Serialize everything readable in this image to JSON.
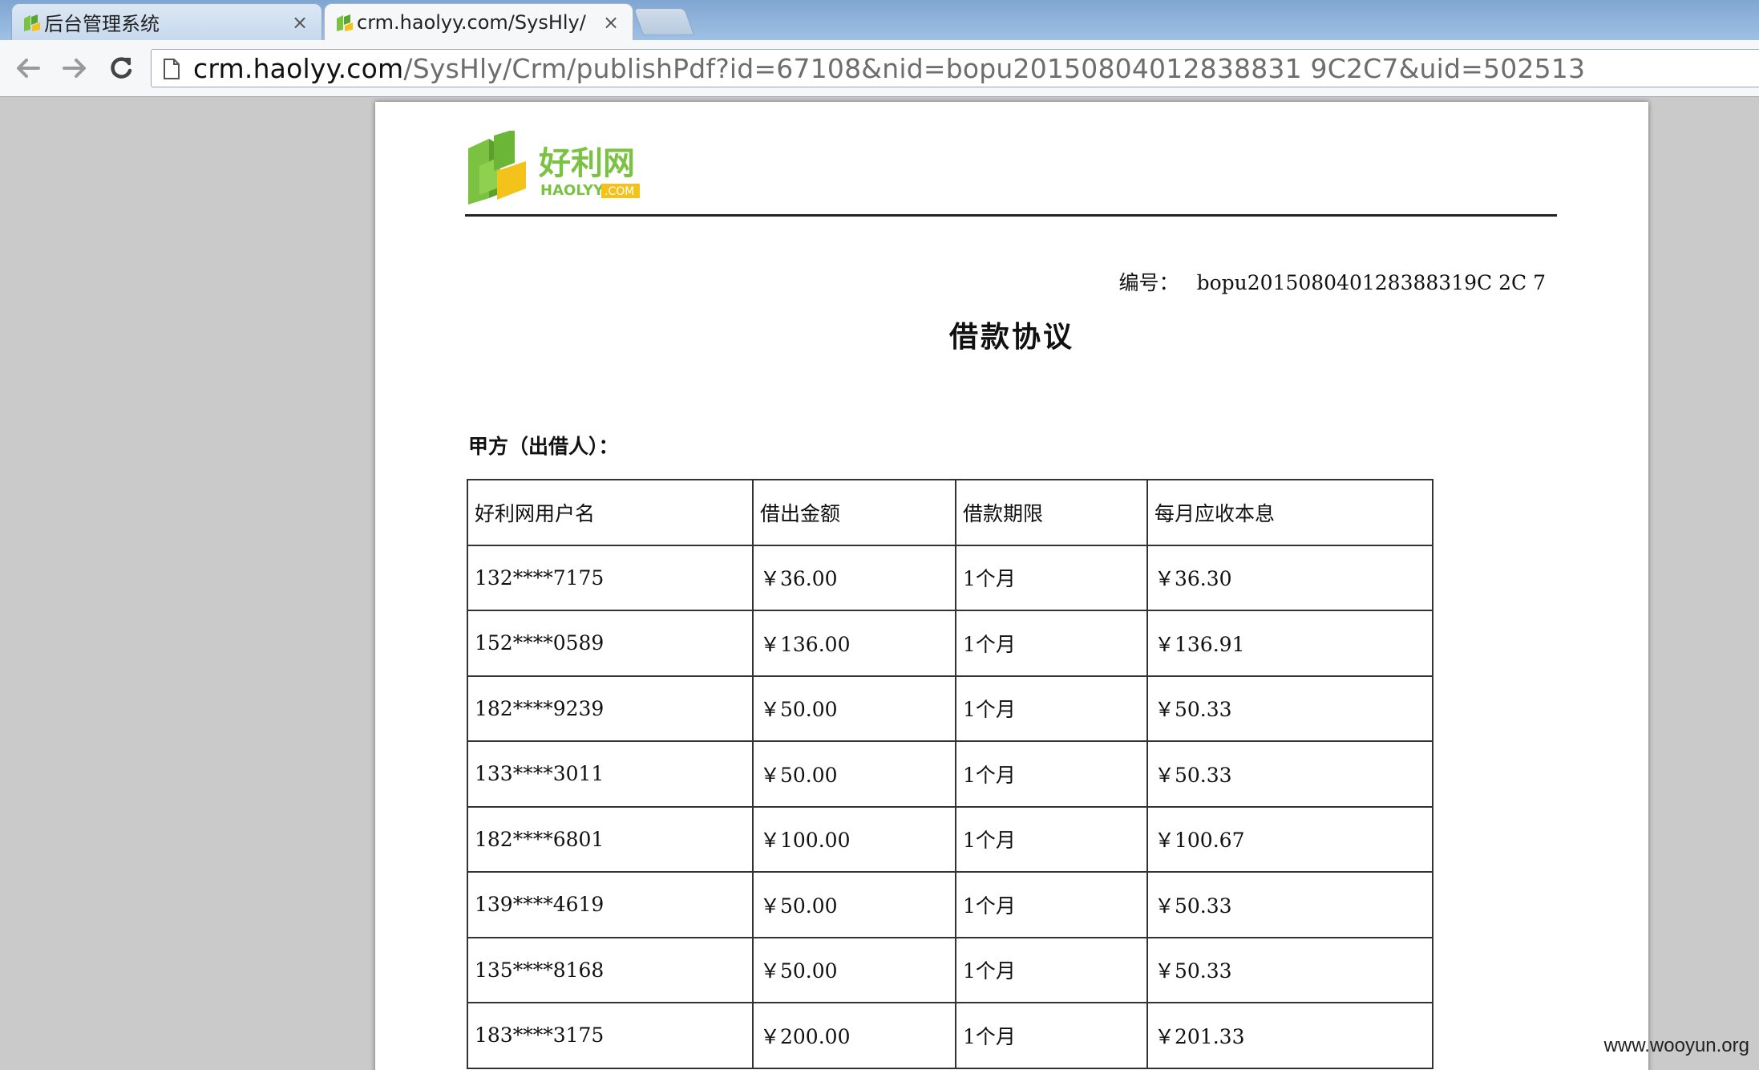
{
  "browser": {
    "tabs": [
      {
        "title": "后台管理系统",
        "close": "×"
      },
      {
        "title": "crm.haolyy.com/SysHly/",
        "close": "×"
      }
    ],
    "address": {
      "host": "crm.haolyy.com",
      "path": "/SysHly/Crm/publishPdf?id=67108&nid=bopu20150804012838831 9C2C7&uid=502513"
    }
  },
  "document": {
    "logo": {
      "brand_cn": "好利网",
      "brand_en": "HAOLYY",
      "domain": ".COM"
    },
    "doc_number_label": "编号：",
    "doc_number": "bopu201508040128388319C 2C 7",
    "title": "借款协议",
    "party_a_label": "甲方（出借人）：",
    "table": {
      "headers": [
        "好利网用户名",
        "借出金额",
        "借款期限",
        "每月应收本息"
      ],
      "rows": [
        [
          "132****7175",
          "￥36.00",
          "1个月",
          "￥36.30"
        ],
        [
          "152****0589",
          "￥136.00",
          "1个月",
          "￥136.91"
        ],
        [
          "182****9239",
          "￥50.00",
          "1个月",
          "￥50.33"
        ],
        [
          "133****3011",
          "￥50.00",
          "1个月",
          "￥50.33"
        ],
        [
          "182****6801",
          "￥100.00",
          "1个月",
          "￥100.67"
        ],
        [
          "139****4619",
          "￥50.00",
          "1个月",
          "￥50.33"
        ],
        [
          "135****8168",
          "￥50.00",
          "1个月",
          "￥50.33"
        ],
        [
          "183****3175",
          "￥200.00",
          "1个月",
          "￥201.33"
        ]
      ]
    }
  },
  "watermark": "www.wooyun.org"
}
